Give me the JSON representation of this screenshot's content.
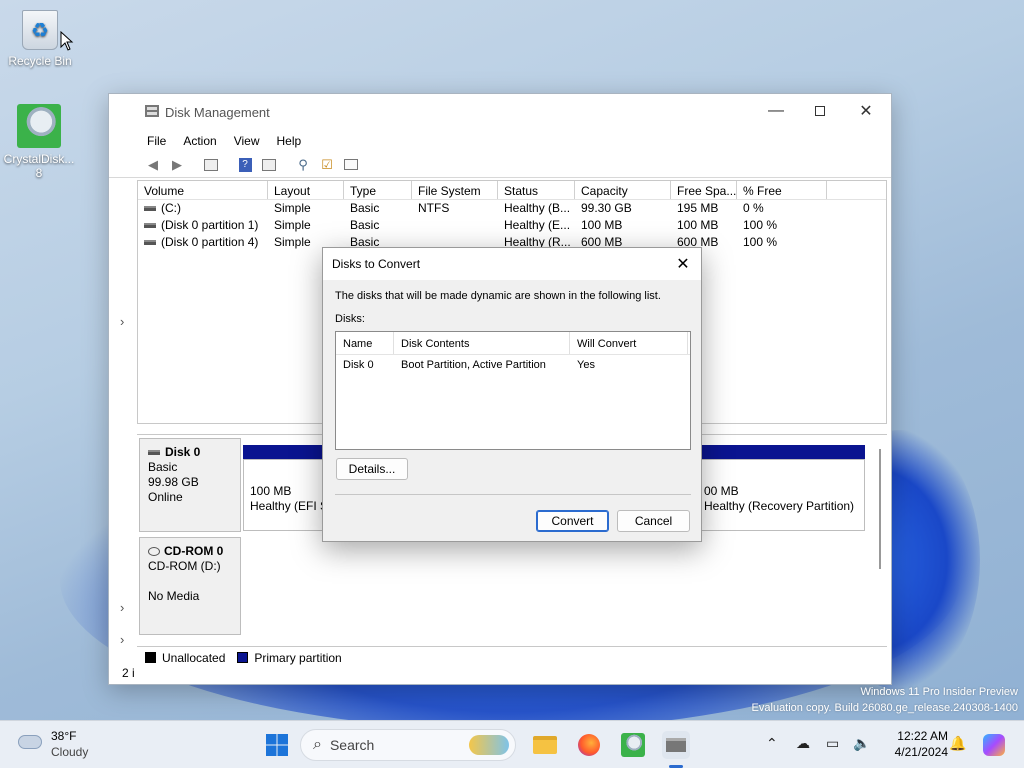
{
  "desktop": {
    "recycle_bin": "Recycle Bin",
    "crystal_line1": "CrystalDisk...",
    "crystal_line2": "8"
  },
  "window": {
    "title": "Disk Management",
    "menu": [
      "File",
      "Action",
      "View",
      "Help"
    ],
    "columns": [
      "Volume",
      "Layout",
      "Type",
      "File System",
      "Status",
      "Capacity",
      "Free Spa...",
      "% Free"
    ],
    "rows": [
      [
        "(C:)",
        "Simple",
        "Basic",
        "NTFS",
        "Healthy (B...",
        "99.30 GB",
        "195 MB",
        "0 %"
      ],
      [
        "(Disk 0 partition 1)",
        "Simple",
        "Basic",
        "",
        "Healthy (E...",
        "100 MB",
        "100 MB",
        "100 %"
      ],
      [
        "(Disk 0 partition 4)",
        "Simple",
        "Basic",
        "",
        "Healthy (R...",
        "600 MB",
        "600 MB",
        "100 %"
      ]
    ],
    "disk0": {
      "name": "Disk 0",
      "type": "Basic",
      "size": "99.98 GB",
      "state": "Online",
      "part1_size": "100 MB",
      "part1_status": "Healthy (EFI S",
      "part3_size": "00 MB",
      "part3_status": "Healthy (Recovery Partition)"
    },
    "cdrom": {
      "name": "CD-ROM 0",
      "drive": "CD-ROM (D:)",
      "media": "No Media"
    },
    "legend": {
      "unallocated": "Unallocated",
      "primary": "Primary partition"
    },
    "status_partial": "2 i"
  },
  "dialog": {
    "title": "Disks to Convert",
    "message": "The disks that will be made dynamic are shown in the following list.",
    "disks_label": "Disks:",
    "columns": [
      "Name",
      "Disk Contents",
      "Will Convert"
    ],
    "rows": [
      [
        "Disk 0",
        "Boot Partition, Active Partition",
        "Yes"
      ]
    ],
    "details_button": "Details...",
    "convert_button": "Convert",
    "cancel_button": "Cancel"
  },
  "watermark": {
    "line1": "Windows 11 Pro Insider Preview",
    "line2": "Evaluation copy. Build 26080.ge_release.240308-1400"
  },
  "taskbar": {
    "weather_temp": "38°F",
    "weather_desc": "Cloudy",
    "search_placeholder": "Search",
    "time": "12:22 AM",
    "date": "4/21/2024"
  },
  "colors": {
    "primary_partition": "#0a1490",
    "accent": "#2b6bcf"
  }
}
